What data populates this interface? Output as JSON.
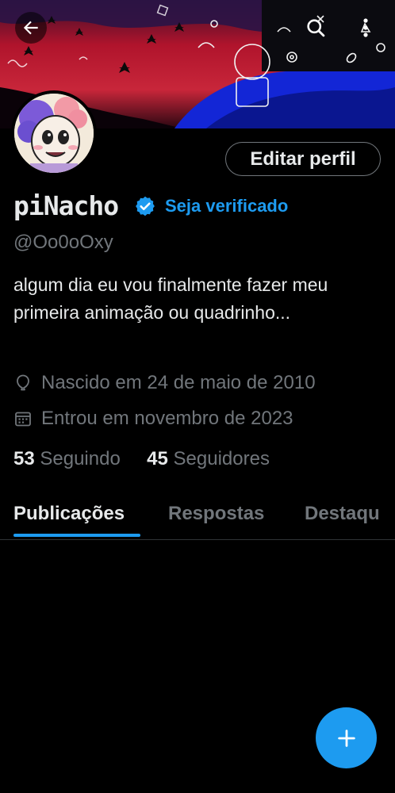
{
  "profile": {
    "display_name": "piNacho",
    "verify_label": "Seja verificado",
    "handle": "@Oo0oOxy",
    "bio": "algum dia eu vou finalmente fazer meu primeira animação ou quadrinho...",
    "birth": "Nascido em 24 de maio de 2010",
    "joined": "Entrou em novembro de 2023",
    "following_count": "53",
    "following_label": "Seguindo",
    "followers_count": "45",
    "followers_label": "Seguidores"
  },
  "header": {
    "edit_button": "Editar perfil"
  },
  "tabs": [
    {
      "label": "Publicações"
    },
    {
      "label": "Respostas"
    },
    {
      "label": "Destaqu"
    }
  ],
  "icons": {
    "back": "arrow-left-icon",
    "search": "search-icon",
    "more": "more-vertical-icon",
    "verified": "verified-badge-icon",
    "birth": "balloon-icon",
    "joined": "calendar-icon",
    "compose": "plus-icon"
  },
  "colors": {
    "accent": "#1d9bf0",
    "text": "#e7e9ea",
    "muted": "#71767b",
    "background": "#000000"
  }
}
